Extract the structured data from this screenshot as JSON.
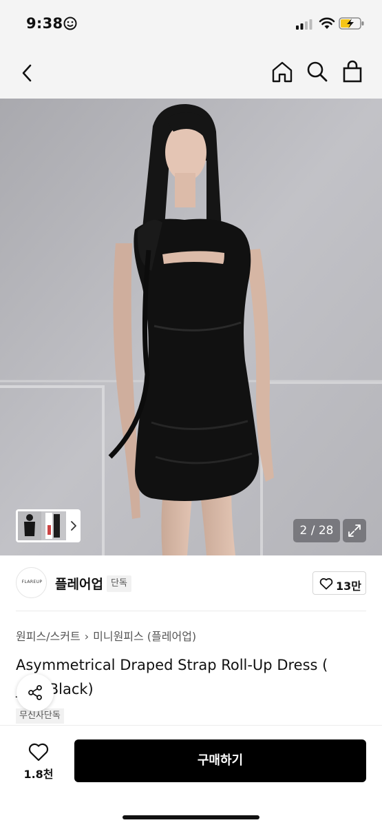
{
  "status_bar": {
    "time": "9:38",
    "icons": [
      "smiley-icon",
      "cellular-signal-icon",
      "wifi-icon",
      "battery-charging-icon"
    ]
  },
  "nav": {
    "icons": [
      "back-arrow-icon",
      "home-icon",
      "search-icon",
      "shopping-bag-icon"
    ]
  },
  "gallery": {
    "counter": "2 / 28",
    "current": 2,
    "total": 28,
    "icons": [
      "thumbnail-next-chevron-icon",
      "expand-icon"
    ]
  },
  "brand": {
    "logo_text": "FLAREUP",
    "name": "플레어업",
    "badge": "단독",
    "likes": "13만"
  },
  "product": {
    "breadcrumb": [
      "원피스/스커트",
      "미니원피스 (플레어업)"
    ],
    "title": "Asymmetrical Draped Strap Roll-Up Dress ( _71_Black)",
    "tag": "무신사단독"
  },
  "bottom_bar": {
    "wish_count": "1.8천",
    "buy_label": "구매하기"
  },
  "colors": {
    "top_background": "#f4f4f4",
    "buy_button": "#000000",
    "badge_background": "#f1f1f1",
    "photo_wall": "#b9b9bd"
  }
}
